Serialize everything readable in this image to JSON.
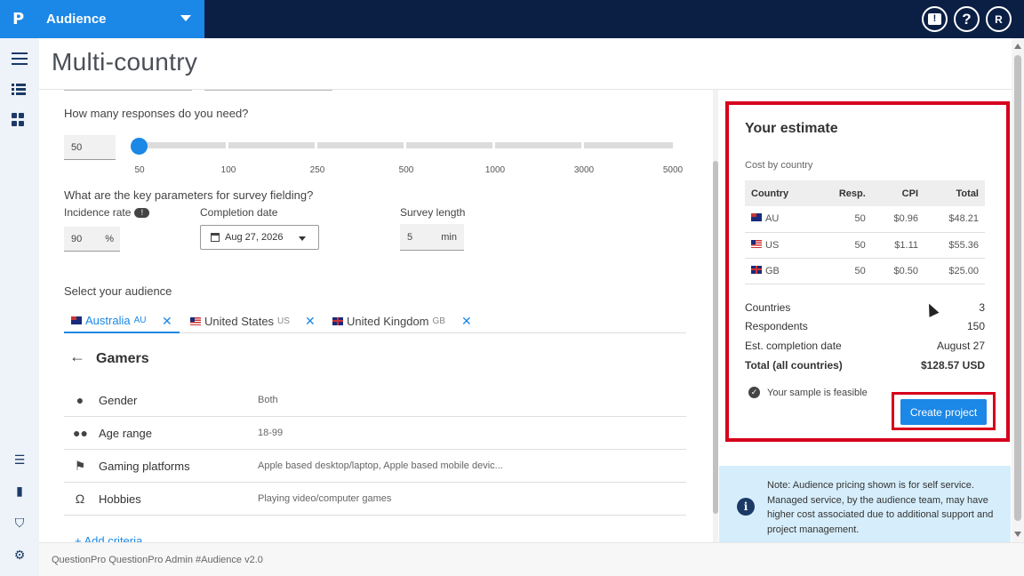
{
  "app": {
    "logo": "P",
    "name": "Audience"
  },
  "topbar": {
    "feedback_icon": "!",
    "help_icon": "?",
    "avatar_initial": "R"
  },
  "page": {
    "title": "Multi-country"
  },
  "responses": {
    "question": "How many responses do you need?",
    "value": "50",
    "ticks": [
      "50",
      "100",
      "250",
      "500",
      "1000",
      "3000",
      "5000"
    ]
  },
  "fielding": {
    "question": "What are the key parameters for survey fielding?",
    "incidence_label": "Incidence rate",
    "incidence_badge": "!",
    "incidence_value": "90",
    "incidence_unit": "%",
    "completion_label": "Completion date",
    "completion_value": "Aug 27, 2026",
    "length_label": "Survey length",
    "length_value": "5",
    "length_unit": "min"
  },
  "audience": {
    "label": "Select your audience",
    "tabs": [
      {
        "name": "Australia",
        "code": "AU"
      },
      {
        "name": "United States",
        "code": "US"
      },
      {
        "name": "United Kingdom",
        "code": "GB"
      }
    ],
    "close_glyph": "✕",
    "back_glyph": "←",
    "group_title": "Gamers",
    "criteria": [
      {
        "name": "Gender",
        "value": "Both",
        "icon": "person-icon"
      },
      {
        "name": "Age range",
        "value": "18-99",
        "icon": "people-icon"
      },
      {
        "name": "Gaming platforms",
        "value": "Apple based desktop/laptop, Apple based mobile devic...",
        "icon": "flag-icon"
      },
      {
        "name": "Hobbies",
        "value": "Playing video/computer games",
        "icon": "headphones-icon"
      }
    ],
    "add_criteria": "+ Add criteria"
  },
  "estimate": {
    "title": "Your estimate",
    "subtitle": "Cost by country",
    "columns": [
      "Country",
      "Resp.",
      "CPI",
      "Total"
    ],
    "rows": [
      {
        "country": "AU",
        "resp": "50",
        "cpi": "$0.96",
        "total": "$48.21"
      },
      {
        "country": "US",
        "resp": "50",
        "cpi": "$1.11",
        "total": "$55.36"
      },
      {
        "country": "GB",
        "resp": "50",
        "cpi": "$0.50",
        "total": "$25.00"
      }
    ],
    "countries_label": "Countries",
    "countries_value": "3",
    "respondents_label": "Respondents",
    "respondents_value": "150",
    "completion_label": "Est. completion date",
    "completion_value": "August 27",
    "total_label": "Total (all countries)",
    "total_value": "$128.57 USD",
    "feasible_text": "Your sample is feasible",
    "check_glyph": "✓",
    "create_button": "Create project"
  },
  "note": {
    "icon": "i",
    "text": "Note: Audience pricing shown is for self service. Managed service, by the audience team, may have higher cost associated due to additional support and project management."
  },
  "footer": {
    "text": "QuestionPro QuestionPro Admin  #Audience v2.0"
  },
  "colors": {
    "primary": "#1b87e6",
    "topbar": "#0b1f45",
    "highlight": "#d6001c"
  }
}
